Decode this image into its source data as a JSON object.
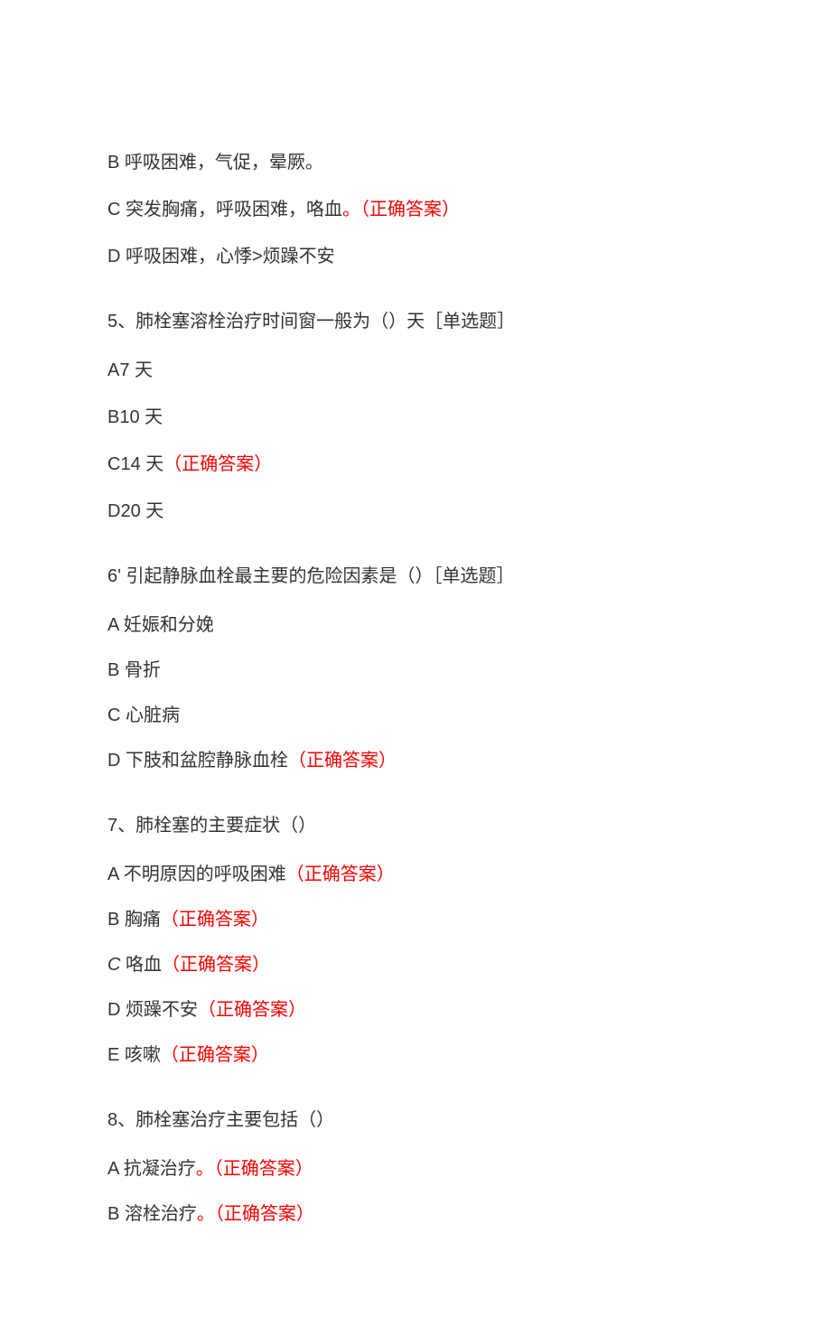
{
  "correct_label": "（正确答案）",
  "correct_label_period": "。（正确答案）",
  "q4_options": {
    "b": "B 呼吸困难，气促，晕厥。",
    "c_text": "C 突发胸痛，呼吸困难，咯血",
    "d": "D 呼吸困难，心悸>烦躁不安"
  },
  "q5": {
    "title": "5、肺栓塞溶栓治疗时间窗一般为（）天［单选题］",
    "a": "A7 天",
    "b": "B10 天",
    "c_text": "C14 天",
    "d": "D20 天"
  },
  "q6": {
    "title": "6' 引起静脉血栓最主要的危险因素是（）［单选题］",
    "a": "A 妊娠和分娩",
    "b": "B 骨折",
    "c": "C 心脏病",
    "d_text": "D 下肢和盆腔静脉血栓"
  },
  "q7": {
    "title": "7、肺栓塞的主要症状（）",
    "a_text": "A 不明原因的呼吸困难",
    "b_text": "B 胸痛",
    "c_prefix": "C",
    "c_text": "咯血",
    "d_text": "D 烦躁不安",
    "e_text": "E 咳嗽"
  },
  "q8": {
    "title": "8、肺栓塞治疗主要包括（）",
    "a_text": "A 抗凝治疗",
    "b_text": "B 溶栓治疗"
  }
}
